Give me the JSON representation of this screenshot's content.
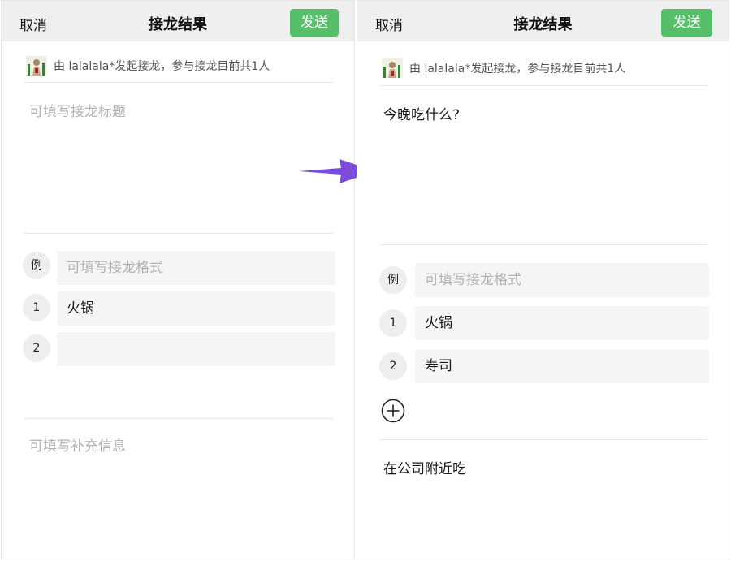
{
  "left": {
    "nav": {
      "cancel": "取消",
      "title": "接龙结果",
      "send": "发送"
    },
    "initiator": "由 lalalala*发起接龙，参与接龙目前共1人",
    "title_placeholder": "可填写接龙标题",
    "items": [
      {
        "badge": "例",
        "value": "",
        "placeholder": "可填写接龙格式"
      },
      {
        "badge": "1",
        "value": "火锅"
      },
      {
        "badge": "2",
        "value": ""
      }
    ],
    "extra_placeholder": "可填写补充信息"
  },
  "right": {
    "nav": {
      "cancel": "取消",
      "title": "接龙结果",
      "send": "发送"
    },
    "initiator": "由 lalalala*发起接龙，参与接龙目前共1人",
    "title_value": "今晚吃什么?",
    "items": [
      {
        "badge": "例",
        "value": "",
        "placeholder": "可填写接龙格式"
      },
      {
        "badge": "1",
        "value": "火锅"
      },
      {
        "badge": "2",
        "value": "寿司"
      }
    ],
    "add_icon": "plus-circle-icon",
    "extra_value": "在公司附近吃"
  },
  "colors": {
    "send_button": "#57be6a",
    "arrow": "#7c4ddb",
    "navbar": "#efefef"
  }
}
